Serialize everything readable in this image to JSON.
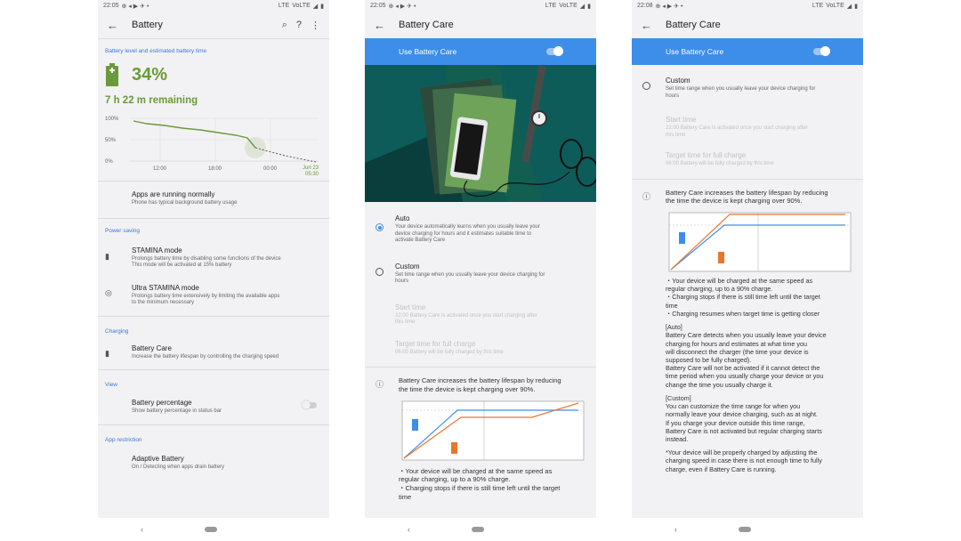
{
  "status": {
    "p1": {
      "time": "22:05",
      "net": "LTE",
      "volte": "VoLTE"
    },
    "p2": {
      "time": "22:05",
      "net": "LTE",
      "volte": "VoLTE"
    },
    "p3": {
      "time": "22:08",
      "net": "LTE",
      "volte": "VoLTE"
    }
  },
  "battery": {
    "title": "Battery",
    "section_level": "Battery level and estimated battery time",
    "percent": "34%",
    "remaining": "7 h  22 m remaining",
    "graph": {
      "y_ticks": [
        "100%",
        "50%",
        "0%"
      ],
      "x_ticks": [
        "12:00",
        "18:00",
        "00:00"
      ],
      "end_date": "Jun 23",
      "end_time": "05:30"
    },
    "apps_running": {
      "title": "Apps are running normally",
      "sub": "Phone has typical background battery usage"
    },
    "power_saving": {
      "header": "Power saving",
      "stamina": {
        "title": "STAMINA mode",
        "sub1": "Prolongs battery time by disabling some functions of the device",
        "sub2": "This mode will be activated at 15% battery"
      },
      "ultra": {
        "title": "Ultra STAMINA mode",
        "sub1": "Prolongs battery time extensively by limiting the available apps",
        "sub2": "to the minimum necessary"
      }
    },
    "charging": {
      "header": "Charging",
      "title": "Battery Care",
      "sub": "Increase the battery lifespan by controlling the charging speed"
    },
    "view": {
      "header": "View",
      "title": "Battery percentage",
      "sub": "Show battery percentage in status bar"
    },
    "app_restriction": {
      "header": "App restriction",
      "title": "Adaptive Battery",
      "sub": "On / Detecting when apps drain battery"
    }
  },
  "care": {
    "title": "Battery Care",
    "use_label": "Use Battery Care",
    "auto": {
      "title": "Auto",
      "sub1": "Your device automatically learns when you usually leave your",
      "sub2": "device charging for hours and it estimates suitable time to",
      "sub3": "activate Battery Care"
    },
    "custom": {
      "title": "Custom",
      "sub1": "Set time range when you usually leave your device charging for",
      "sub2": "hours"
    },
    "start": {
      "title": "Start time",
      "sub1": "22:00   Battery Care is activated once you start charging after",
      "sub2": "this time"
    },
    "target": {
      "title": "Target time for full charge",
      "sub": "06:00   Battery will be fully charged by this time"
    },
    "info1": "Battery Care increases the battery lifespan by reducing",
    "info2": "the time the device is kept charging over 90%.",
    "bullets": [
      "・Your device will be charged at the same speed as",
      "regular charging, up to a 90% charge.",
      "・Charging stops if there is still time left until the target",
      "time",
      "・Charging resumes when target time is getting closer"
    ],
    "auto_block": [
      "[Auto]",
      "Battery Care detects when you usually leave your device",
      "charging for hours and estimates at what time you",
      "will disconnect the charger (the time your device is",
      "supposed to be fully charged).",
      "Battery Care will not be activated if it cannot detect the",
      "time period when you usually charge your device or you",
      "change the time you usually charge it."
    ],
    "custom_block": [
      "[Custom]",
      "You can customize the time range for when you",
      "normally leave your device charging, such as at night.",
      "If you charge your device outside this time range,",
      "Battery Care is not activated but regular charging starts",
      "instead."
    ],
    "note_block": [
      "*Your device will be properly charged by adjusting the",
      "charging speed in case there is not enough time to fully",
      "charge, even if Battery Care is running."
    ]
  },
  "colors": {
    "accent": "#3d8ee8",
    "battery_green": "#6b9a3a",
    "chart_orange": "#e8772e",
    "chart_blue": "#3d8ee8"
  }
}
